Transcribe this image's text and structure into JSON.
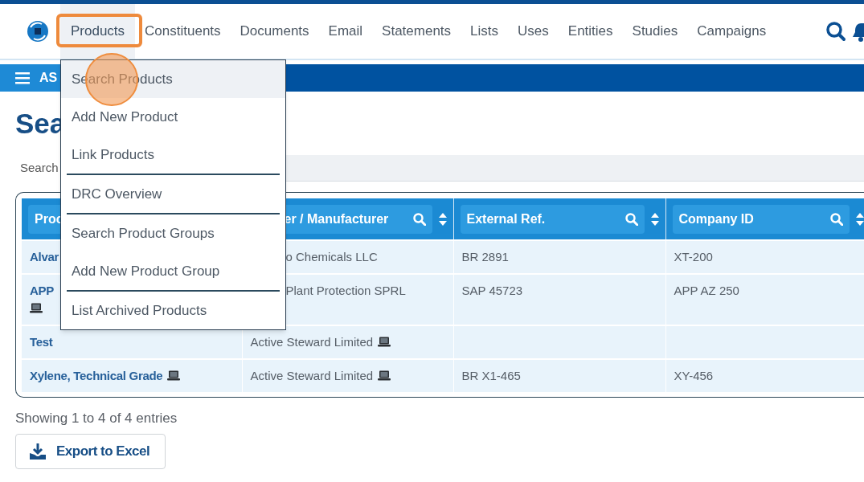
{
  "nav": {
    "items": [
      {
        "label": "Products",
        "selected": true,
        "highlighted": true
      },
      {
        "label": "Constituents",
        "selected": false,
        "highlighted": false
      },
      {
        "label": "Documents",
        "selected": false,
        "highlighted": false
      },
      {
        "label": "Email",
        "selected": false,
        "highlighted": false
      },
      {
        "label": "Statements",
        "selected": false,
        "highlighted": false
      },
      {
        "label": "Lists",
        "selected": false,
        "highlighted": false
      },
      {
        "label": "Uses",
        "selected": false,
        "highlighted": false
      },
      {
        "label": "Entities",
        "selected": false,
        "highlighted": false
      },
      {
        "label": "Studies",
        "selected": false,
        "highlighted": false
      },
      {
        "label": "Campaigns",
        "selected": false,
        "highlighted": false
      }
    ]
  },
  "band": {
    "label": "AS"
  },
  "page_title": "Sea",
  "search": {
    "label": "Search"
  },
  "table": {
    "columns": [
      {
        "label": "Proc",
        "tools": false
      },
      {
        "label": "er / Manufacturer",
        "tools": true
      },
      {
        "label": "External Ref.",
        "tools": true
      },
      {
        "label": "Company ID",
        "tools": true
      }
    ],
    "rows": [
      [
        {
          "text": "Alvar",
          "marked": false
        },
        {
          "text": "o Chemicals LLC",
          "marked": false
        },
        {
          "text": "BR 2891",
          "marked": false
        },
        {
          "text": "XT-200",
          "marked": false
        }
      ],
      [
        {
          "text": "APP",
          "marked": true
        },
        {
          "text": "Plant Protection SPRL",
          "marked": false
        },
        {
          "text": "SAP 45723",
          "marked": false
        },
        {
          "text": "APP AZ 250",
          "marked": false
        }
      ],
      [
        {
          "text": "Test",
          "marked": false
        },
        {
          "text": "Active Steward Limited",
          "marked": true
        },
        {
          "marked": false
        },
        {
          "marked": false
        }
      ],
      [
        {
          "text": "Xylene, Technical Grade",
          "marked": true
        },
        {
          "text": "Active Steward Limited",
          "marked": true
        },
        {
          "text": "BR X1-465",
          "marked": false
        },
        {
          "text": "XY-456",
          "marked": false
        }
      ]
    ]
  },
  "footer": {
    "info": "Showing 1 to 4 of 4 entries",
    "export_button": "Export to Excel"
  },
  "dropdown": {
    "items": [
      {
        "label": "Search Products",
        "selected": true,
        "clicked": true,
        "divider": false
      },
      {
        "label": "Add New Product",
        "selected": false,
        "clicked": false,
        "divider": false
      },
      {
        "label": "Link Products",
        "selected": false,
        "clicked": false,
        "divider": true
      },
      {
        "label": "DRC Overview",
        "selected": false,
        "clicked": false,
        "divider": true
      },
      {
        "label": "Search Product Groups",
        "selected": false,
        "clicked": false,
        "divider": false
      },
      {
        "label": "Add New Product Group",
        "selected": false,
        "clicked": false,
        "divider": true
      },
      {
        "label": "List Archived Products",
        "selected": false,
        "clicked": false,
        "divider": false
      }
    ]
  }
}
